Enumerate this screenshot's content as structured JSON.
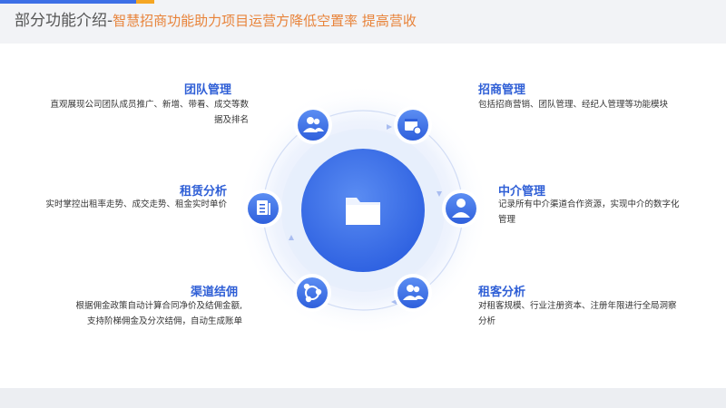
{
  "title": {
    "main": "部分功能介绍",
    "separator": "-",
    "subtitle": "智慧招商功能助力项目运营方降低空置率 提高营收"
  },
  "features": {
    "team": {
      "heading": "团队管理",
      "desc": "直观展现公司团队成员推广、新增、带看、成交等数据及排名",
      "icon": "team-users-icon"
    },
    "rental": {
      "heading": "租赁分析",
      "desc": "实时掌控出租率走势、成交走势、租金实时单价",
      "icon": "document-report-icon"
    },
    "channel": {
      "heading": "渠道结佣",
      "desc_line1": "根据佣金政策自动计算合同净价及结佣金额,",
      "desc_line2": "支持阶梯佣金及分次结佣，自动生成账单",
      "icon": "channel-share-icon"
    },
    "invest": {
      "heading": "招商管理",
      "desc": "包括招商营销、团队管理、经纪人管理等功能模块",
      "icon": "building-settings-icon"
    },
    "agency": {
      "heading": "中介管理",
      "desc": "记录所有中介渠道合作资源，实现中介的数字化管理",
      "icon": "agent-person-icon"
    },
    "tenant": {
      "heading": "租客分析",
      "desc": "对租客规模、行业注册资本、注册年限进行全局洞察分析",
      "icon": "tenant-users-icon"
    }
  },
  "center": {
    "icon": "folder-icon"
  },
  "colors": {
    "accent": "#3d6fe6",
    "orange": "#e8833a",
    "heading": "#2f5fd6"
  }
}
